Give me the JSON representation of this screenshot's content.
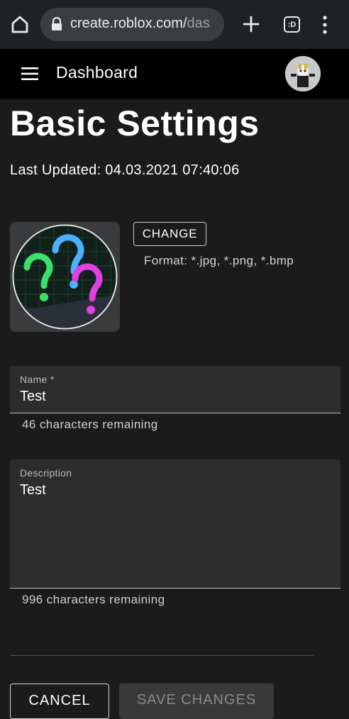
{
  "browser": {
    "url_main": "create.roblox.com/",
    "url_rest": "das",
    "tab_count_label": ":D"
  },
  "header": {
    "title": "Dashboard"
  },
  "page": {
    "title": "Basic Settings",
    "last_updated": "Last Updated: 04.03.2021 07:40:06"
  },
  "icon_section": {
    "change_label": "CHANGE",
    "format_text": "Format: *.jpg, *.png, *.bmp"
  },
  "name_field": {
    "label": "Name *",
    "value": "Test",
    "helper": "46 characters remaining"
  },
  "description_field": {
    "label": "Description",
    "value": "Test",
    "helper": "996 characters remaining"
  },
  "actions": {
    "cancel_label": "CANCEL",
    "save_label": "SAVE CHANGES"
  }
}
